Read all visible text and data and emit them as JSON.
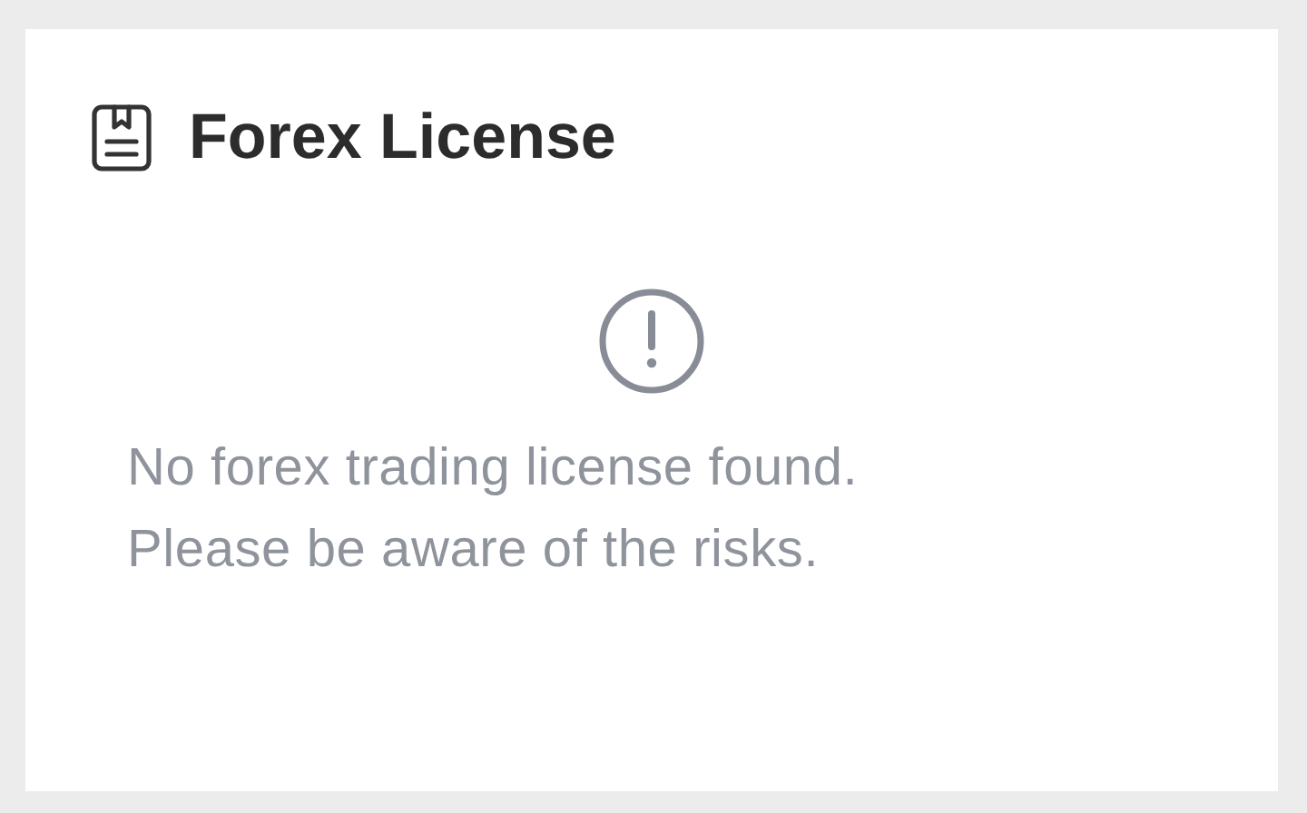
{
  "card": {
    "title": "Forex License",
    "message_lines": [
      "No forex trading license found.",
      "Please be aware of the risks."
    ]
  }
}
